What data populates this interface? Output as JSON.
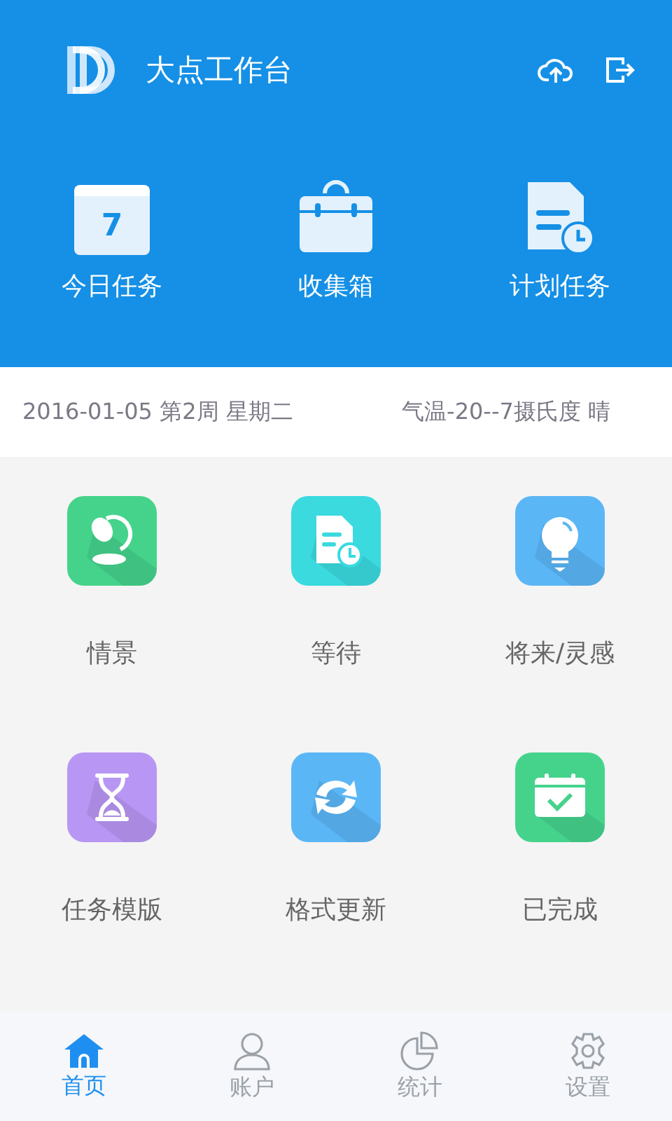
{
  "header": {
    "title": "大点工作台"
  },
  "quick_actions": [
    {
      "kind": "calendar",
      "label": "今日任务",
      "badge": "7"
    },
    {
      "kind": "toolbox",
      "label": "收集箱"
    },
    {
      "kind": "plan",
      "label": "计划任务"
    }
  ],
  "info_bar": {
    "date": "2016-01-05 第2周 星期二",
    "weather": "气温-20--7摄氏度 晴"
  },
  "modules": [
    {
      "kind": "lamp",
      "label": "情景",
      "color": "#45d38c"
    },
    {
      "kind": "plan",
      "label": "等待",
      "color": "#3adadf"
    },
    {
      "kind": "bulb",
      "label": "将来/灵感",
      "color": "#5bb6f6"
    },
    {
      "kind": "hourglass",
      "label": "任务模版",
      "color": "#b896f4"
    },
    {
      "kind": "refresh",
      "label": "格式更新",
      "color": "#5bb6f6"
    },
    {
      "kind": "done",
      "label": "已完成",
      "color": "#45d38c"
    }
  ],
  "tabs": [
    {
      "kind": "home",
      "label": "首页",
      "selected": true
    },
    {
      "kind": "user",
      "label": "账户",
      "selected": false
    },
    {
      "kind": "chart",
      "label": "统计",
      "selected": false
    },
    {
      "kind": "gear",
      "label": "设置",
      "selected": false
    }
  ]
}
